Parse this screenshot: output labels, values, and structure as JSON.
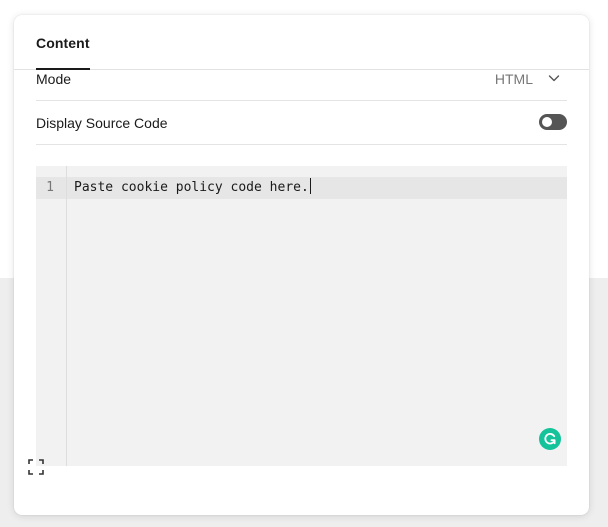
{
  "tabs": [
    {
      "label": "Content",
      "active": true
    }
  ],
  "mode": {
    "label": "Mode",
    "value": "HTML",
    "icon": "chevron-down-icon"
  },
  "source_code": {
    "label": "Display Source Code",
    "toggle_on": false,
    "toggle_color": "#555555"
  },
  "editor": {
    "lines": [
      {
        "number": "1",
        "text": "Paste cookie policy code here."
      }
    ],
    "background": "#f2f2f2"
  },
  "icons": {
    "assistant": "grammarly-icon",
    "assistant_color": "#15c39a",
    "expand": "expand-icon"
  }
}
